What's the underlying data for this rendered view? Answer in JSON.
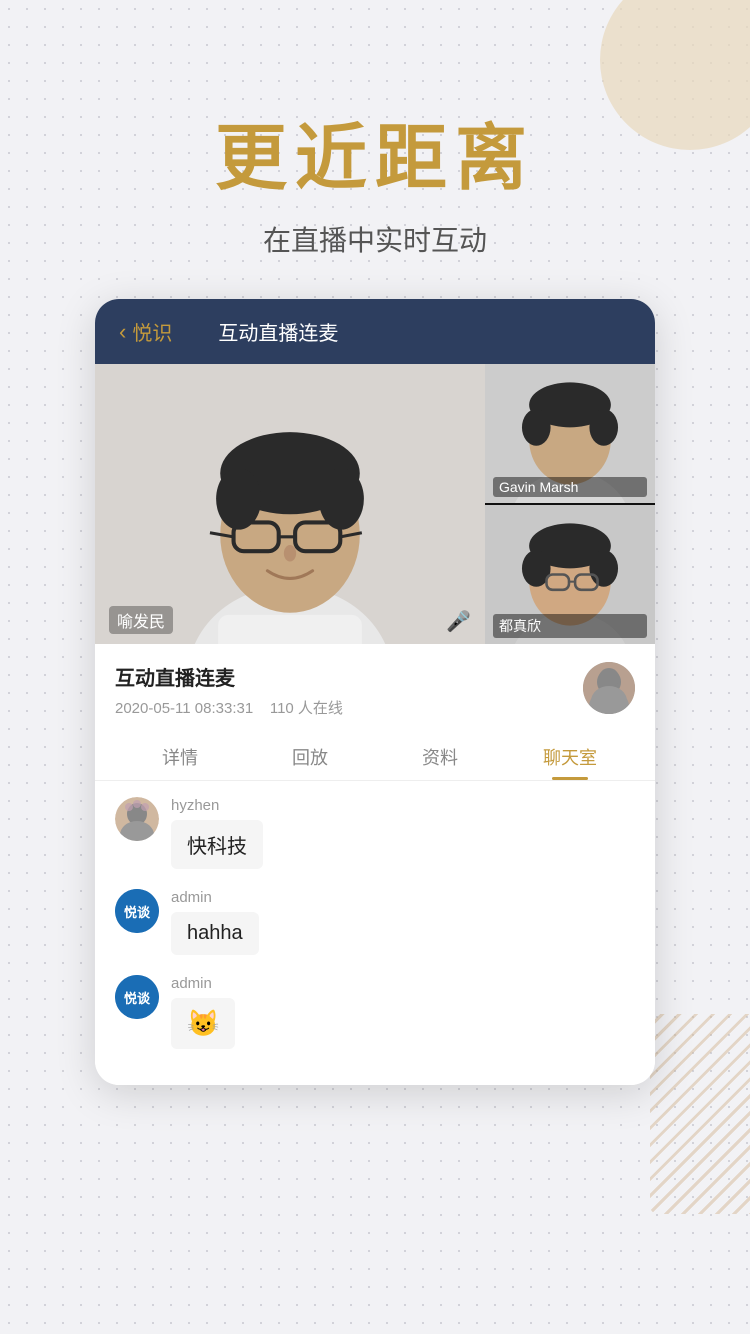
{
  "page": {
    "background_color": "#f2f2f5"
  },
  "header": {
    "main_title": "更近距离",
    "sub_title": "在直播中实时互动"
  },
  "app": {
    "back_icon": "‹",
    "back_label": "悦识",
    "nav_title": "互动直播连麦",
    "video_main_person": "喻发民",
    "video_side_1_person": "Gavin Marsh",
    "video_side_2_person": "都真欣",
    "info_title": "互动直播连麦",
    "info_date": "2020-05-11 08:33:31",
    "info_online": "110 人在线",
    "tabs": [
      {
        "label": "详情",
        "active": false
      },
      {
        "label": "回放",
        "active": false
      },
      {
        "label": "资料",
        "active": false
      },
      {
        "label": "聊天室",
        "active": true
      }
    ],
    "chat_messages": [
      {
        "username": "hyzhen",
        "avatar_type": "photo",
        "message": "快科技"
      },
      {
        "username": "admin",
        "avatar_type": "logo",
        "avatar_text": "悦谈",
        "message": "hahha"
      },
      {
        "username": "admin",
        "avatar_type": "logo",
        "avatar_text": "悦谈",
        "message": "🐱"
      }
    ]
  }
}
